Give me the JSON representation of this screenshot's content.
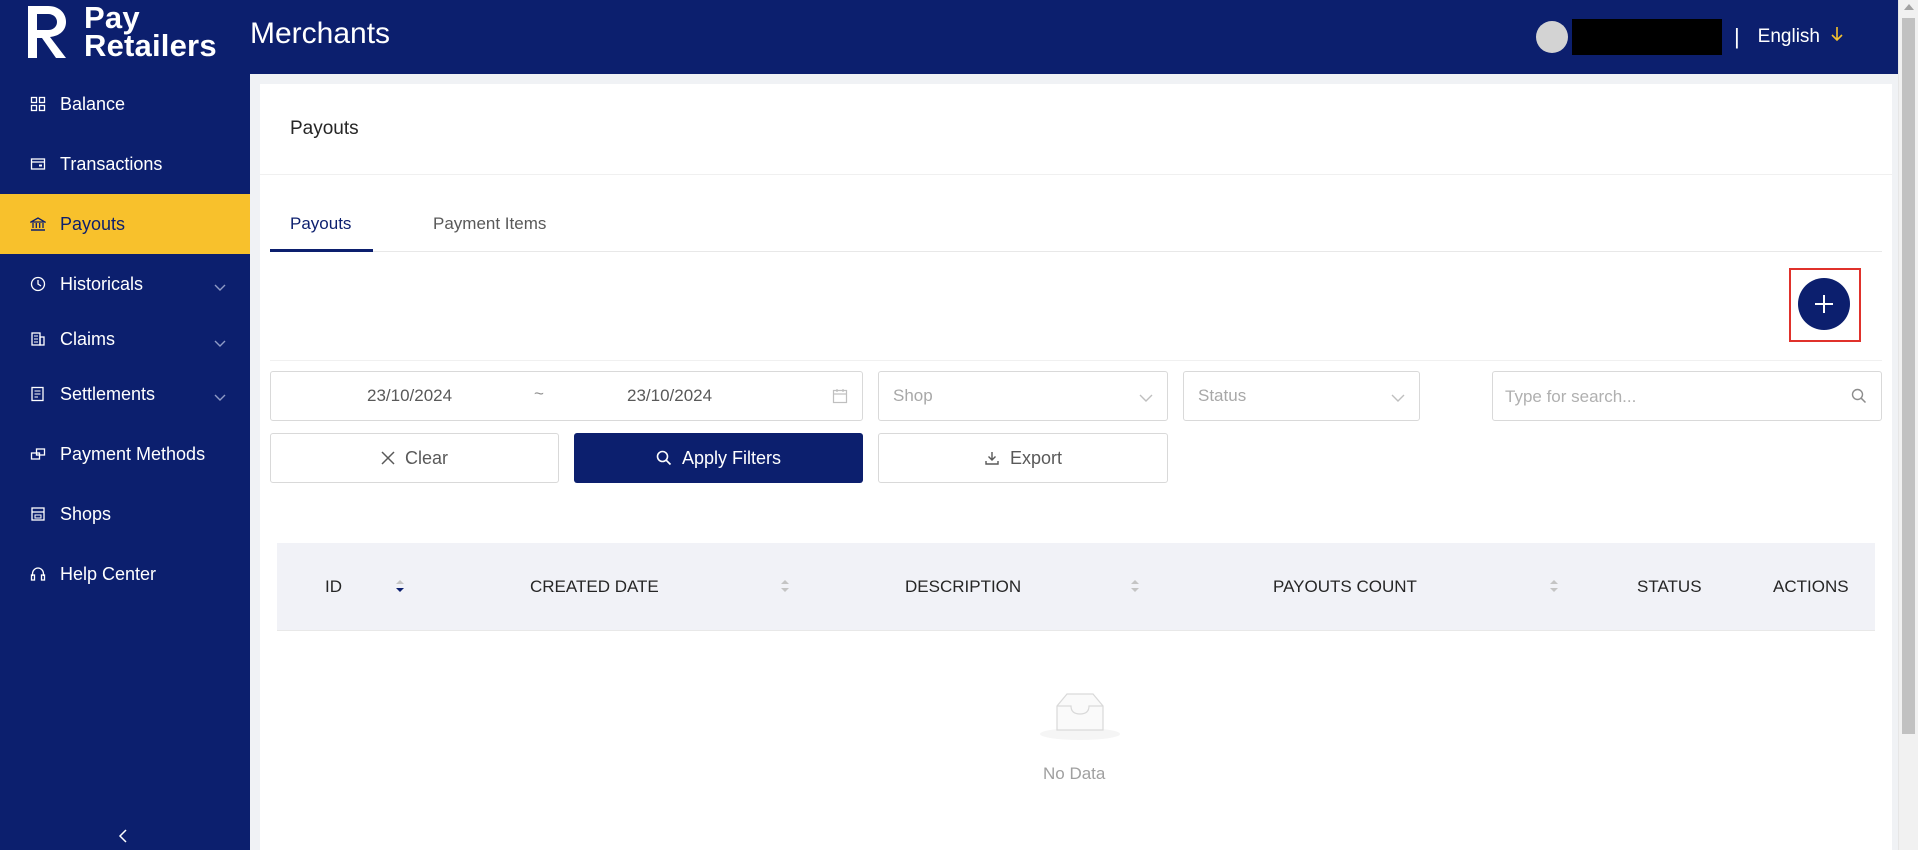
{
  "header": {
    "logo_line1": "Pay",
    "logo_line2": "Retailers",
    "title": "Merchants",
    "separator": "|",
    "language": "English"
  },
  "sidebar": {
    "items": [
      {
        "label": "Balance",
        "icon": "grid-icon"
      },
      {
        "label": "Transactions",
        "icon": "wallet-icon"
      },
      {
        "label": "Payouts",
        "icon": "bank-icon",
        "active": true
      },
      {
        "label": "Historicals",
        "icon": "clock-icon",
        "expandable": true
      },
      {
        "label": "Claims",
        "icon": "building-icon",
        "expandable": true
      },
      {
        "label": "Settlements",
        "icon": "ledger-icon",
        "expandable": true
      },
      {
        "label": "Payment Methods",
        "icon": "cards-icon"
      },
      {
        "label": "Shops",
        "icon": "store-icon"
      },
      {
        "label": "Help Center",
        "icon": "headset-icon"
      }
    ],
    "collapse_icon": "chevron-left-icon"
  },
  "main": {
    "page_title": "Payouts",
    "tabs": [
      {
        "label": "Payouts",
        "active": true
      },
      {
        "label": "Payment Items",
        "active": false
      }
    ],
    "filters": {
      "date_start": "23/10/2024",
      "date_separator": "~",
      "date_end": "23/10/2024",
      "shop_placeholder": "Shop",
      "status_placeholder": "Status",
      "search_placeholder": "Type for search..."
    },
    "buttons": {
      "clear": "Clear",
      "apply": "Apply Filters",
      "export": "Export"
    },
    "table": {
      "columns": [
        "ID",
        "CREATED DATE",
        "DESCRIPTION",
        "PAYOUTS COUNT",
        "STATUS",
        "ACTIONS"
      ],
      "empty_text": "No Data"
    }
  },
  "colors": {
    "primary": "#0c1f6e",
    "accent": "#f8c12c",
    "highlight": "#e0312b"
  }
}
